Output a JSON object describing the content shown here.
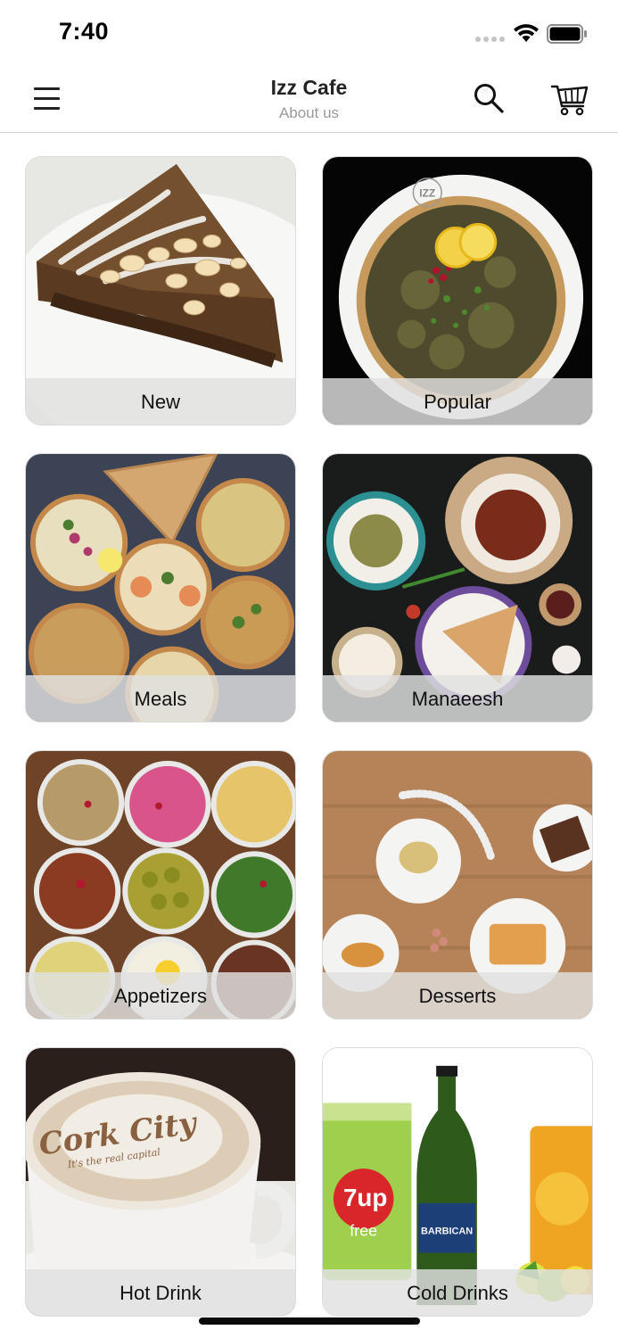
{
  "status_bar": {
    "time": "7:40"
  },
  "nav": {
    "title": "Izz Cafe",
    "subtitle": "About us"
  },
  "categories": [
    {
      "label": "New",
      "icon": "cake-slice-image"
    },
    {
      "label": "Popular",
      "icon": "manaeesh-plate-image"
    },
    {
      "label": "Meals",
      "icon": "savory-pies-image"
    },
    {
      "label": "Manaeesh",
      "icon": "manaeesh-spread-image"
    },
    {
      "label": "Appetizers",
      "icon": "mezze-bowls-image"
    },
    {
      "label": "Desserts",
      "icon": "dessert-plates-image"
    },
    {
      "label": "Hot Drink",
      "icon": "cappuccino-image"
    },
    {
      "label": "Cold Drinks",
      "icon": "soft-drinks-image"
    }
  ],
  "photo_text": {
    "latte_art": "Cork City",
    "latte_art_small": "It's the real capital",
    "can_brand": "7up",
    "can_sub": "free",
    "bottle_brand": "BARBICAN",
    "plate_stamp": "IZZ"
  },
  "colors": {
    "accent_text": "#111111",
    "subtitle": "#9a9a9a",
    "label_band": "#e1e1e1"
  }
}
